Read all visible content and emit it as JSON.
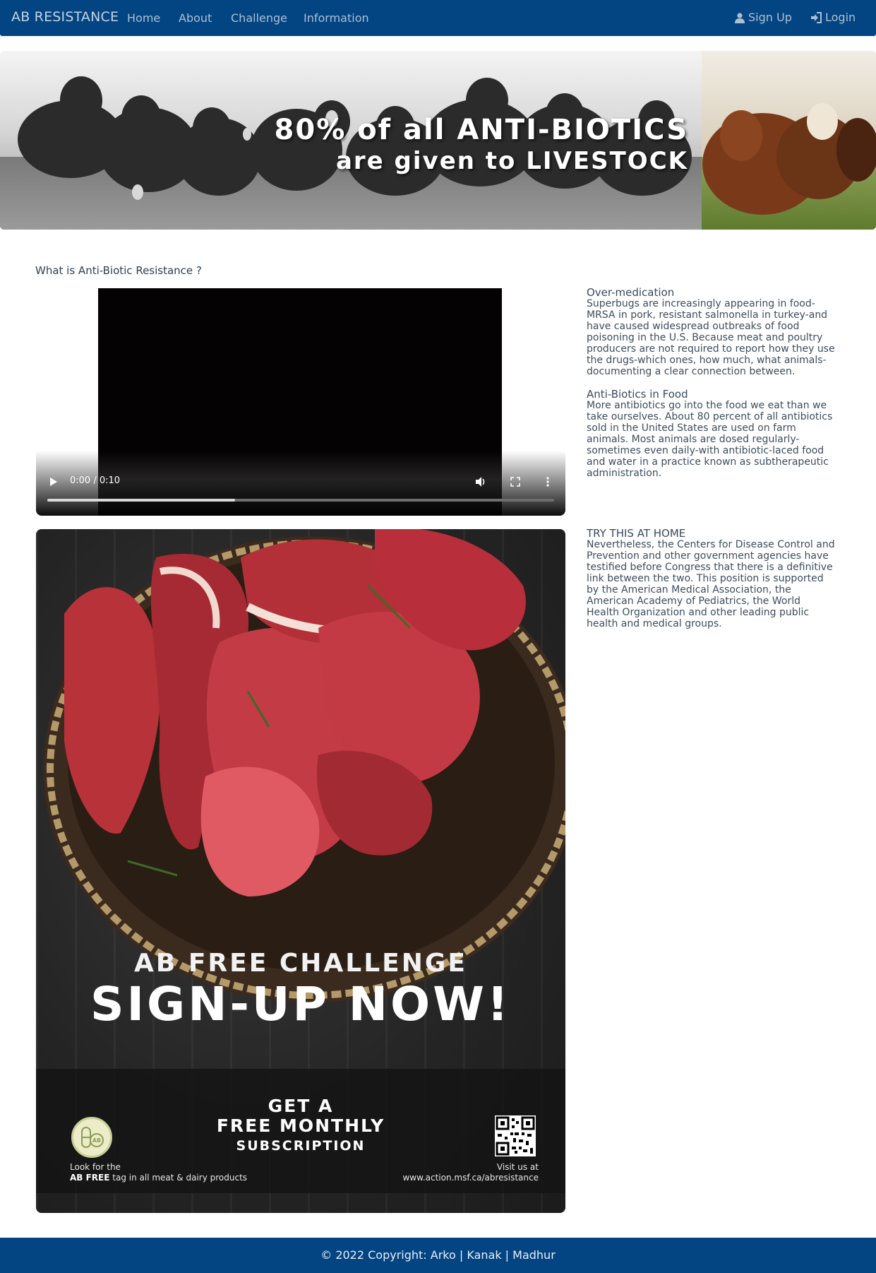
{
  "navbar": {
    "brand": "AB RESISTANCE",
    "links": [
      "Home",
      "About",
      "Challenge",
      "Information"
    ],
    "signup": "Sign Up",
    "login": "Login",
    "background_color": "#034582"
  },
  "hero": {
    "line1": "80% of all ANTI-BIOTICS",
    "line2": "are given to LIVESTOCK"
  },
  "main": {
    "section_title": "What is Anti-Biotic Resistance ?",
    "video": {
      "time": "0:00 / 0:10",
      "progress": 0.37,
      "icons": [
        "play-icon",
        "volume-icon",
        "fullscreen-icon",
        "more-options-icon"
      ]
    },
    "poster": {
      "headline": "AB FREE CHALLENGE",
      "cta": "SIGN-UP NOW!",
      "offer_line1": "GET A",
      "offer_line2": "FREE MONTHLY",
      "offer_line3": "SUBSCRIPTION",
      "look_for_line1": "Look for the",
      "look_for_bold": "AB FREE",
      "look_for_rest": " tag in all meat & dairy products",
      "badge_text": "AB",
      "visit_line1": "Visit us at",
      "visit_line2": "www.action.msf.ca/abresistance"
    }
  },
  "sidebar": {
    "blocks": [
      {
        "heading": "Over-medication",
        "lines": [
          "Superbugs are increasingly appearing in food-",
          "MRSA in pork, resistant salmonella in turkey-and",
          "have caused widespread outbreaks of food",
          "poisoning in the U.S. Because meat and poultry",
          "producers are not required to report how they use",
          "the drugs-which ones, how much, what animals-",
          "documenting a clear connection between."
        ]
      },
      {
        "heading": "Anti-Biotics in Food",
        "lines": [
          "More antibiotics go into the food we eat than we",
          "take ourselves. About 80 percent of all antibiotics",
          "sold in the United States are used on farm",
          "animals. Most animals are dosed regularly-",
          "sometimes even daily-with antibiotic-laced food",
          "and water in a practice known as subtherapeutic",
          "administration."
        ]
      },
      {
        "heading": "TRY THIS AT HOME",
        "lines": [
          "Nevertheless, the Centers for Disease Control and",
          "Prevention and other government agencies have",
          "testified before Congress that there is a definitive",
          "link between the two. This position is supported",
          "by the American Medical Association, the",
          "American Academy of Pediatrics, the World",
          "Health Organization and other leading public",
          "health and medical groups."
        ]
      }
    ]
  },
  "footer": {
    "text": "© 2022 Copyright: Arko | Kanak | Madhur"
  }
}
